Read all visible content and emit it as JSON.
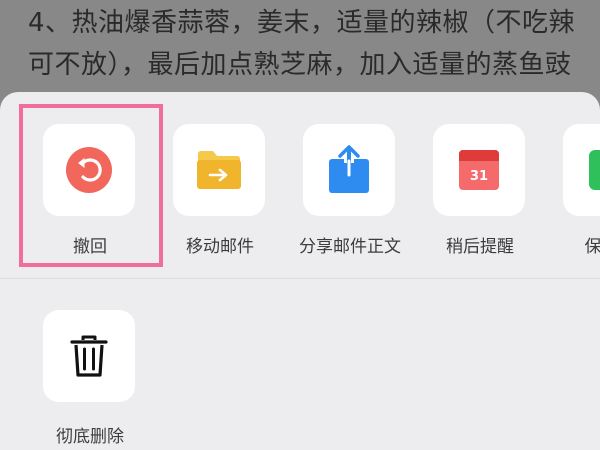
{
  "background_text": {
    "line1": "4、热油爆香蒜蓉，姜末，适量的辣椒（不吃辣",
    "line2": "可不放），最后加点熟芝麻，加入适量的蒸鱼豉"
  },
  "share_sheet": {
    "actions_row1": [
      {
        "id": "undo",
        "label": "撤回",
        "icon": "undo-icon",
        "color": "#f2675c",
        "highlighted": true
      },
      {
        "id": "move",
        "label": "移动邮件",
        "icon": "folder-move-icon",
        "color": "#f0b52c"
      },
      {
        "id": "share",
        "label": "分享邮件正文",
        "icon": "share-icon",
        "color": "#2e8bf0"
      },
      {
        "id": "remind",
        "label": "稍后提醒",
        "icon": "calendar-icon",
        "color": "#ef4b4b",
        "calendar_day": "31"
      },
      {
        "id": "save",
        "label": "保存到",
        "icon": "save-icon",
        "color": "#2fbf5b"
      }
    ],
    "actions_row2": [
      {
        "id": "delete",
        "label": "彻底删除",
        "icon": "trash-icon",
        "color": "#111111"
      }
    ]
  },
  "colors": {
    "sheet_background": "#ededef",
    "tile_background": "#ffffff",
    "highlight_border": "#ef6e9a"
  }
}
